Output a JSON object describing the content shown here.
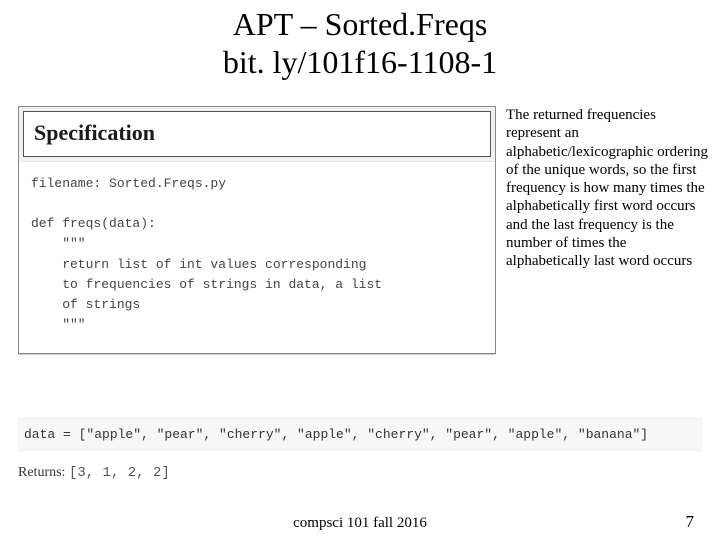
{
  "title_line1": "APT – Sorted.Freqs",
  "title_line2": "bit. ly/101f16-1108-1",
  "spec_heading": "Specification",
  "code": "filename: Sorted.Freqs.py\n\ndef freqs(data):\n    \"\"\"\n    return list of int values corresponding\n    to frequencies of strings in data, a list\n    of strings\n    \"\"\"",
  "paragraph": "The returned frequencies represent an alphabetic/lexicographic ordering of the  unique words, so the first frequency is how many times the alphabetically first word occurs and the last frequency is the number of times the alphabetically last word occurs",
  "data_line": "data = [\"apple\", \"pear\", \"cherry\", \"apple\", \"cherry\", \"pear\", \"apple\", \"banana\"]",
  "returns_label": "Returns:",
  "returns_value": "[3, 1, 2, 2]",
  "footer_left": "compsci 101 fall 2016",
  "footer_right": "7"
}
